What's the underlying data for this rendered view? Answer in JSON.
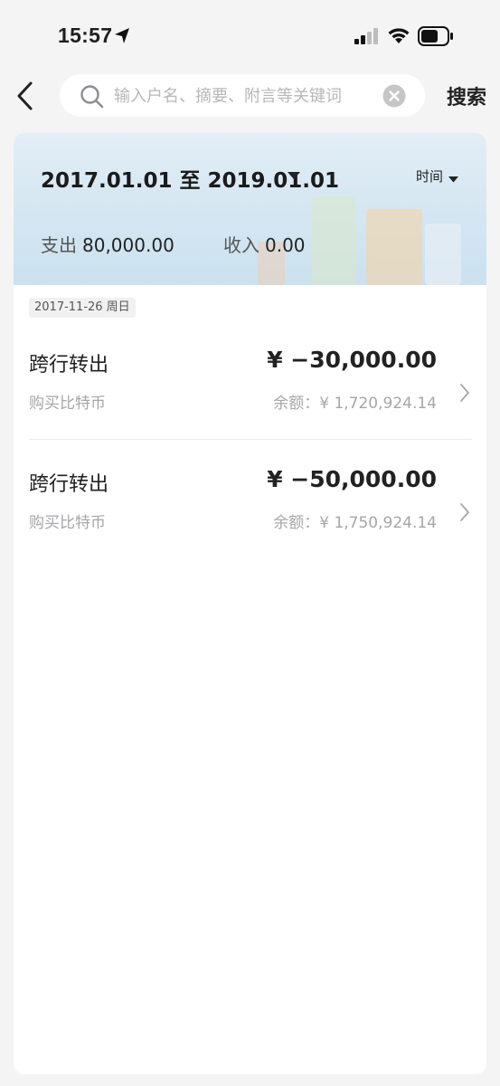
{
  "status_bar": {
    "time": "15:57",
    "icons": [
      "location-arrow-icon",
      "signal-icon",
      "wifi-icon",
      "battery-icon"
    ]
  },
  "header": {
    "back_icon": "chevron-left-icon",
    "search_placeholder": "输入户名、摘要、附言等关键词",
    "search_value": "",
    "search_button": "搜索"
  },
  "summary": {
    "date_range": "2017.01.01 至 2019.01.01",
    "sort_label": "时间",
    "expense_label": "支出",
    "expense_value": "80,000.00",
    "income_label": "收入",
    "income_value": "0.00"
  },
  "groups": [
    {
      "date": "2017-11-26 周日",
      "transactions": [
        {
          "title": "跨行转出",
          "amount": "¥ −30,000.00",
          "memo": "购买比特币",
          "balance": "余额：¥ 1,720,924.14"
        },
        {
          "title": "跨行转出",
          "amount": "¥ −50,000.00",
          "memo": "购买比特币",
          "balance": "余额：¥ 1,750,924.14"
        }
      ]
    }
  ],
  "colors": {
    "page_bg": "#f4f4f5",
    "card_bg": "#ffffff",
    "banner_bg": "#d4e6f2",
    "secondary_text": "#a6a6a9"
  }
}
